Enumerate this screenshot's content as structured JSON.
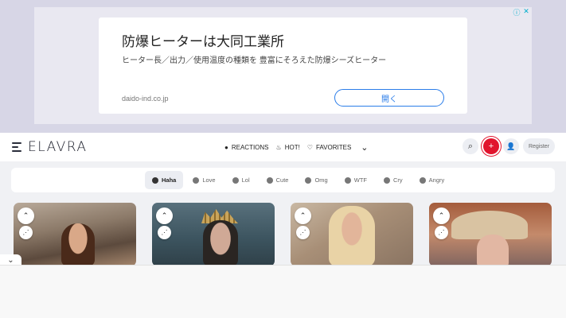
{
  "ad": {
    "title": "防爆ヒーターは大同工業所",
    "description": "ヒーター長／出力／使用温度の種類を 豊富にそろえた防爆シーズヒーター",
    "domain": "daido-ind.co.jp",
    "cta": "開く",
    "badge_info": "ⓘ",
    "badge_close": "✕"
  },
  "header": {
    "logo": "ELAVRA",
    "nav": [
      {
        "icon": "reactions-icon",
        "glyph": "●",
        "label": "REACTIONS"
      },
      {
        "icon": "fire-icon",
        "glyph": "♨",
        "label": "HOT!"
      },
      {
        "icon": "heart-icon",
        "glyph": "♡",
        "label": "FAVORITES"
      }
    ],
    "more_glyph": "⌄",
    "search_glyph": "⌕",
    "plus_glyph": "+",
    "user_glyph": "👤",
    "register": "Register"
  },
  "reactions": [
    {
      "label": "Haha",
      "active": true
    },
    {
      "label": "Love",
      "active": false
    },
    {
      "label": "Lol",
      "active": false
    },
    {
      "label": "Cute",
      "active": false
    },
    {
      "label": "Omg",
      "active": false
    },
    {
      "label": "WTF",
      "active": false
    },
    {
      "label": "Cry",
      "active": false
    },
    {
      "label": "Angry",
      "active": false
    }
  ],
  "cards": [
    {
      "up": "⌃",
      "share": "⋰"
    },
    {
      "up": "⌃",
      "share": "⋰"
    },
    {
      "up": "⌃",
      "share": "⋰"
    },
    {
      "up": "⌃",
      "share": "⋰"
    }
  ],
  "collapse_glyph": "⌄",
  "colors": {
    "accent": "#e1142d",
    "ad_link": "#2b7de9"
  }
}
